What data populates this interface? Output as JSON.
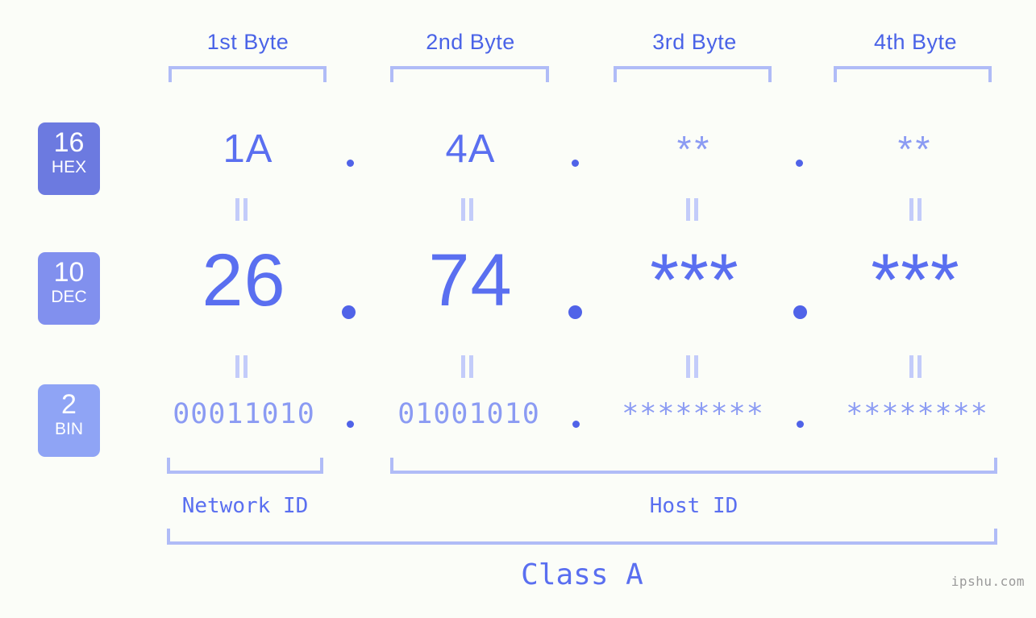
{
  "page": {
    "background_color": "#fbfdf8",
    "accent_color": "#5a6ff0",
    "muted_accent_color": "#8b9bf3",
    "bracket_color": "#b0bcf7",
    "watermark": "ipshu.com"
  },
  "byte_headers": [
    {
      "label": "1st Byte"
    },
    {
      "label": "2nd Byte"
    },
    {
      "label": "3rd Byte"
    },
    {
      "label": "4th Byte"
    }
  ],
  "bases": [
    {
      "number": "16",
      "name": "HEX",
      "color": "#6c7ae0"
    },
    {
      "number": "10",
      "name": "DEC",
      "color": "#8190ee"
    },
    {
      "number": "2",
      "name": "BIN",
      "color": "#8fa4f5"
    }
  ],
  "rows": {
    "hex": {
      "base_number": "16",
      "base_name": "HEX",
      "values": [
        "1A",
        "4A",
        "**",
        "**"
      ],
      "separators": [
        ".",
        ".",
        "."
      ]
    },
    "dec": {
      "base_number": "10",
      "base_name": "DEC",
      "values": [
        "26",
        "74",
        "***",
        "***"
      ],
      "separators": [
        ".",
        ".",
        "."
      ]
    },
    "bin": {
      "base_number": "2",
      "base_name": "BIN",
      "values": [
        "00011010",
        "01001010",
        "********",
        "********"
      ],
      "separators": [
        ".",
        ".",
        "."
      ]
    }
  },
  "equality_marks": {
    "glyph": "||",
    "count_per_gap": 4,
    "gaps": [
      "hex-to-dec",
      "dec-to-bin"
    ]
  },
  "id_sections": [
    {
      "label": "Network ID",
      "span_bytes": 1
    },
    {
      "label": "Host ID",
      "span_bytes": 3
    }
  ],
  "class_section": {
    "label": "Class A",
    "span_bytes": 4
  }
}
